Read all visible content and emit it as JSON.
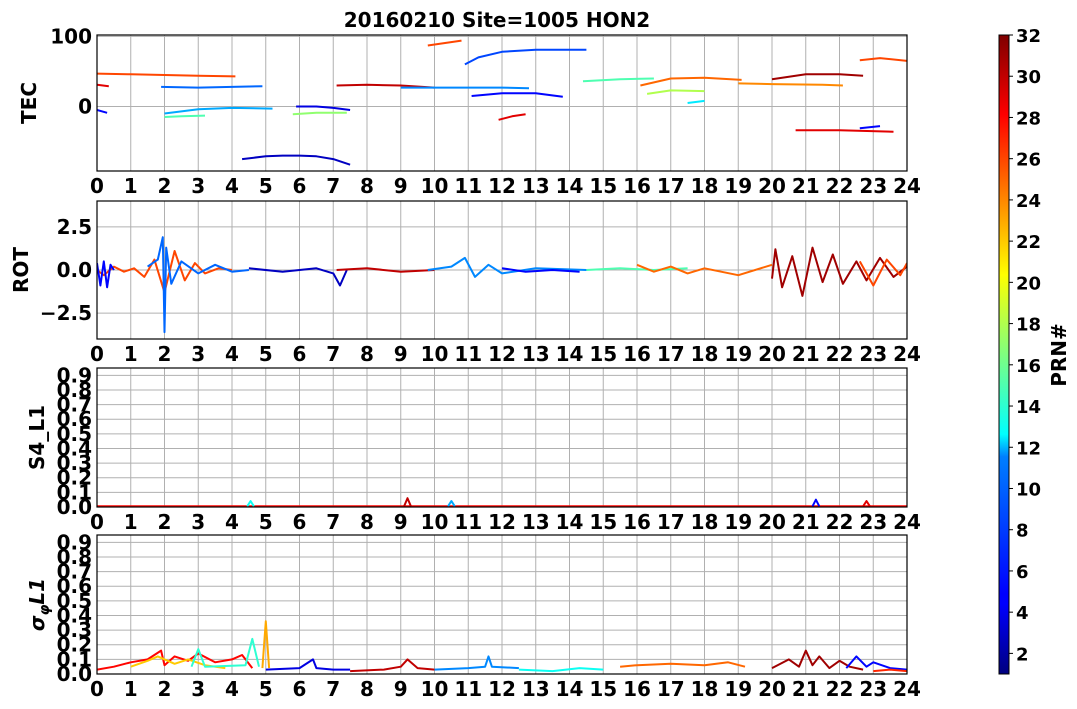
{
  "title": "20160210 Site=1005 HON2",
  "colorbar": {
    "label": "PRN#",
    "min": 1,
    "max": 32,
    "ticks": [
      "2",
      "4",
      "6",
      "8",
      "10",
      "12",
      "14",
      "16",
      "18",
      "20",
      "22",
      "24",
      "26",
      "28",
      "30",
      "32"
    ],
    "colormap": "jet"
  },
  "x_ticks": [
    "0",
    "1",
    "2",
    "3",
    "4",
    "5",
    "6",
    "7",
    "8",
    "9",
    "10",
    "11",
    "12",
    "13",
    "14",
    "15",
    "16",
    "17",
    "18",
    "19",
    "20",
    "21",
    "22",
    "23",
    "24"
  ],
  "panels": [
    {
      "id": "tec",
      "ylabel": "TEC",
      "y_ticks": [
        "0",
        "100"
      ],
      "y_tick_values": [
        0,
        100
      ]
    },
    {
      "id": "rot",
      "ylabel": "ROT",
      "y_ticks": [
        "−2.5",
        "0.0",
        "2.5"
      ],
      "y_tick_values": [
        -2.5,
        0,
        2.5
      ]
    },
    {
      "id": "s4",
      "ylabel": "S4_L1",
      "y_ticks": [
        "0.0",
        "0.1",
        "0.2",
        "0.3",
        "0.4",
        "0.5",
        "0.6",
        "0.7",
        "0.8",
        "0.9"
      ],
      "y_tick_values": [
        0,
        0.1,
        0.2,
        0.3,
        0.4,
        0.5,
        0.6,
        0.7,
        0.8,
        0.9
      ]
    },
    {
      "id": "sigma",
      "ylabel": "σφL1",
      "y_ticks": [
        "0.0",
        "0.1",
        "0.2",
        "0.3",
        "0.4",
        "0.5",
        "0.6",
        "0.7",
        "0.8",
        "0.9"
      ],
      "y_tick_values": [
        0,
        0.1,
        0.2,
        0.3,
        0.4,
        0.5,
        0.6,
        0.7,
        0.8,
        0.9
      ]
    }
  ],
  "chart_data": [
    {
      "type": "line",
      "panel": "tec",
      "title": "20160210 Site=1005 HON2",
      "xlabel": "",
      "ylabel": "TEC",
      "xlim": [
        0,
        24
      ],
      "ylim": [
        -92,
        102
      ],
      "grid": true,
      "series": [
        {
          "prn": 26,
          "x": [
            0,
            1,
            2,
            3,
            4.1
          ],
          "y": [
            47,
            46,
            45,
            44,
            43
          ]
        },
        {
          "prn": 29,
          "x": [
            0,
            0.35
          ],
          "y": [
            31,
            29
          ]
        },
        {
          "prn": 5,
          "x": [
            0,
            0.3
          ],
          "y": [
            -5,
            -9
          ]
        },
        {
          "prn": 8,
          "x": [
            1.9,
            3,
            4,
            4.9
          ],
          "y": [
            28,
            27,
            28,
            29
          ]
        },
        {
          "prn": 10,
          "x": [
            2,
            3,
            4,
            5.2
          ],
          "y": [
            -10,
            -4,
            -2,
            -3
          ]
        },
        {
          "prn": 15,
          "x": [
            2,
            2.5,
            3.2
          ],
          "y": [
            -15,
            -14,
            -13
          ]
        },
        {
          "prn": 3,
          "x": [
            4.3,
            5,
            5.5,
            6,
            6.5,
            7,
            7.5
          ],
          "y": [
            -75,
            -71,
            -70,
            -70,
            -71,
            -75,
            -83
          ]
        },
        {
          "prn": 4,
          "x": [
            5.9,
            6.5,
            7,
            7.5
          ],
          "y": [
            0,
            0,
            -2,
            -5
          ]
        },
        {
          "prn": 17,
          "x": [
            5.8,
            6.5,
            7.4
          ],
          "y": [
            -11,
            -9,
            -9
          ]
        },
        {
          "prn": 30,
          "x": [
            7.1,
            8,
            9,
            10
          ],
          "y": [
            30,
            31,
            30,
            27
          ]
        },
        {
          "prn": 9,
          "x": [
            9,
            10,
            11,
            12,
            12.8
          ],
          "y": [
            27,
            27,
            27,
            27,
            26
          ]
        },
        {
          "prn": 26,
          "x": [
            9.8,
            10.8
          ],
          "y": [
            87,
            94
          ]
        },
        {
          "prn": 7,
          "x": [
            10.9,
            11.3,
            12,
            13,
            14.5
          ],
          "y": [
            60,
            70,
            78,
            81,
            81
          ]
        },
        {
          "prn": 5,
          "x": [
            11.1,
            12,
            13,
            13.8
          ],
          "y": [
            15,
            19,
            19,
            14
          ]
        },
        {
          "prn": 29,
          "x": [
            11.9,
            12.3,
            12.7
          ],
          "y": [
            -19,
            -14,
            -11
          ]
        },
        {
          "prn": 15,
          "x": [
            14.4,
            15.5,
            16.5
          ],
          "y": [
            36,
            39,
            40
          ]
        },
        {
          "prn": 25,
          "x": [
            16.1,
            17,
            18,
            19.1
          ],
          "y": [
            30,
            40,
            41,
            38
          ]
        },
        {
          "prn": 18,
          "x": [
            16.3,
            17,
            18
          ],
          "y": [
            18,
            23,
            22
          ]
        },
        {
          "prn": 12,
          "x": [
            17.5,
            18
          ],
          "y": [
            5,
            8
          ]
        },
        {
          "prn": 24,
          "x": [
            19,
            20,
            21.5,
            22.1
          ],
          "y": [
            33,
            32,
            31,
            30
          ]
        },
        {
          "prn": 31,
          "x": [
            20,
            21,
            22,
            22.7
          ],
          "y": [
            39,
            46,
            46,
            44
          ]
        },
        {
          "prn": 26,
          "x": [
            22.6,
            23.2,
            24
          ],
          "y": [
            66,
            69,
            65
          ]
        },
        {
          "prn": 29,
          "x": [
            20.7,
            22,
            23.6
          ],
          "y": [
            -34,
            -34,
            -36
          ]
        },
        {
          "prn": 5,
          "x": [
            22.6,
            23.2
          ],
          "y": [
            -31,
            -28
          ]
        }
      ]
    },
    {
      "type": "line",
      "panel": "rot",
      "xlabel": "",
      "ylabel": "ROT",
      "xlim": [
        0,
        24
      ],
      "ylim": [
        -4,
        4
      ],
      "grid": true,
      "series": [
        {
          "prn": 26,
          "x": [
            0,
            0.2,
            0.5,
            0.8,
            1.1,
            1.4,
            1.7,
            2.0,
            2.3,
            2.6,
            2.9,
            3.2,
            3.6,
            4.0
          ],
          "y": [
            0,
            -0.3,
            0.2,
            -0.1,
            0.1,
            -0.4,
            0.6,
            -1.3,
            1.1,
            -0.6,
            0.4,
            -0.2,
            0.1,
            0
          ]
        },
        {
          "prn": 5,
          "x": [
            0,
            0.1,
            0.2,
            0.3,
            0.4,
            0.5
          ],
          "y": [
            0.4,
            -0.9,
            0.5,
            -1.0,
            0.3,
            0
          ]
        },
        {
          "prn": 8,
          "x": [
            1.5,
            1.8,
            1.95,
            2.0,
            2.05,
            2.2,
            2.5,
            3.0,
            3.5,
            4.0,
            4.5
          ],
          "y": [
            0.2,
            0.6,
            1.9,
            -3.6,
            1.3,
            -0.8,
            0.5,
            -0.2,
            0.3,
            -0.1,
            0
          ]
        },
        {
          "prn": 3,
          "x": [
            4.5,
            5.5,
            6.5,
            7.0,
            7.2,
            7.4
          ],
          "y": [
            0.1,
            -0.1,
            0.1,
            -0.2,
            -0.9,
            0
          ]
        },
        {
          "prn": 30,
          "x": [
            7.1,
            8,
            9,
            10
          ],
          "y": [
            0,
            0.1,
            -0.1,
            0
          ]
        },
        {
          "prn": 9,
          "x": [
            9.8,
            10.5,
            10.9,
            11.2,
            11.6,
            12,
            13,
            14.5
          ],
          "y": [
            0,
            0.2,
            0.7,
            -0.4,
            0.3,
            -0.2,
            0.1,
            0
          ]
        },
        {
          "prn": 5,
          "x": [
            12,
            12.7,
            13.5,
            14.3
          ],
          "y": [
            0.1,
            -0.1,
            0,
            -0.1
          ]
        },
        {
          "prn": 15,
          "x": [
            14.5,
            15.5,
            16.5,
            17.5
          ],
          "y": [
            0,
            0.1,
            0,
            0.1
          ]
        },
        {
          "prn": 25,
          "x": [
            16,
            16.5,
            17,
            17.5,
            18,
            19,
            20
          ],
          "y": [
            0.3,
            -0.1,
            0.2,
            -0.2,
            0.1,
            -0.3,
            0.3
          ]
        },
        {
          "prn": 31,
          "x": [
            20,
            20.1,
            20.3,
            20.6,
            20.9,
            21.2,
            21.5,
            21.8,
            22.1,
            22.5,
            22.8,
            23.2,
            23.6,
            24
          ],
          "y": [
            -0.5,
            1.2,
            -1.0,
            0.8,
            -1.5,
            1.3,
            -0.7,
            0.9,
            -0.8,
            0.5,
            -0.6,
            0.7,
            -0.4,
            0.2
          ]
        },
        {
          "prn": 26,
          "x": [
            22.6,
            23,
            23.4,
            23.8,
            24
          ],
          "y": [
            0.5,
            -0.9,
            0.6,
            -0.3,
            0.4
          ]
        }
      ]
    },
    {
      "type": "line",
      "panel": "s4",
      "xlabel": "",
      "ylabel": "S4_L1",
      "xlim": [
        0,
        24
      ],
      "ylim": [
        0,
        0.95
      ],
      "grid": true,
      "series": [
        {
          "prn": 28,
          "x": [
            0,
            24
          ],
          "y": [
            0.005,
            0.005
          ]
        },
        {
          "prn": 13,
          "x": [
            4.45,
            4.55,
            4.65
          ],
          "y": [
            0.005,
            0.04,
            0.005
          ]
        },
        {
          "prn": 30,
          "x": [
            9.1,
            9.2,
            9.3
          ],
          "y": [
            0.005,
            0.06,
            0.005
          ]
        },
        {
          "prn": 10,
          "x": [
            10.4,
            10.5,
            10.6
          ],
          "y": [
            0.005,
            0.04,
            0.005
          ]
        },
        {
          "prn": 5,
          "x": [
            21.2,
            21.3,
            21.4
          ],
          "y": [
            0.005,
            0.05,
            0.005
          ]
        },
        {
          "prn": 29,
          "x": [
            22.7,
            22.8,
            22.9
          ],
          "y": [
            0.005,
            0.04,
            0.005
          ]
        }
      ]
    },
    {
      "type": "line",
      "panel": "sigma",
      "xlabel": "",
      "ylabel": "σφL1",
      "xlim": [
        0,
        24
      ],
      "ylim": [
        0,
        0.95
      ],
      "grid": true,
      "series": [
        {
          "prn": 28,
          "x": [
            0,
            0.5,
            1,
            1.5,
            1.9,
            2.0,
            2.3,
            2.7,
            3.0,
            3.5,
            4.0,
            4.3,
            4.6
          ],
          "y": [
            0.03,
            0.05,
            0.08,
            0.1,
            0.16,
            0.06,
            0.12,
            0.09,
            0.14,
            0.08,
            0.1,
            0.13,
            0.04
          ]
        },
        {
          "prn": 22,
          "x": [
            1,
            1.5,
            1.8,
            2.3,
            2.7,
            3.2,
            3.8
          ],
          "y": [
            0.05,
            0.09,
            0.12,
            0.07,
            0.1,
            0.06,
            0.04
          ]
        },
        {
          "prn": 14,
          "x": [
            2.8,
            3.0,
            3.2,
            4.4,
            4.6,
            4.8
          ],
          "y": [
            0.05,
            0.17,
            0.05,
            0.06,
            0.24,
            0.05
          ]
        },
        {
          "prn": 23,
          "x": [
            4.9,
            5.0,
            5.1
          ],
          "y": [
            0.04,
            0.36,
            0.04
          ]
        },
        {
          "prn": 4,
          "x": [
            5,
            6,
            6.4,
            6.5,
            7,
            7.5
          ],
          "y": [
            0.03,
            0.04,
            0.1,
            0.04,
            0.03,
            0.03
          ]
        },
        {
          "prn": 30,
          "x": [
            7.5,
            8.5,
            9,
            9.2,
            9.5,
            10
          ],
          "y": [
            0.02,
            0.03,
            0.05,
            0.1,
            0.04,
            0.03
          ]
        },
        {
          "prn": 9,
          "x": [
            10,
            11,
            11.5,
            11.6,
            11.7,
            12.5
          ],
          "y": [
            0.03,
            0.04,
            0.05,
            0.12,
            0.05,
            0.04
          ]
        },
        {
          "prn": 13,
          "x": [
            12.5,
            13.5,
            14.3,
            15
          ],
          "y": [
            0.03,
            0.02,
            0.04,
            0.03
          ]
        },
        {
          "prn": 25,
          "x": [
            15.5,
            16,
            17,
            18,
            18.7,
            19.2
          ],
          "y": [
            0.05,
            0.06,
            0.07,
            0.06,
            0.08,
            0.05
          ]
        },
        {
          "prn": 31,
          "x": [
            20,
            20.5,
            20.8,
            21,
            21.2,
            21.4,
            21.7,
            22,
            22.3,
            22.7
          ],
          "y": [
            0.04,
            0.1,
            0.05,
            0.16,
            0.06,
            0.12,
            0.04,
            0.09,
            0.05,
            0.03
          ]
        },
        {
          "prn": 5,
          "x": [
            22.2,
            22.5,
            22.8,
            23.0,
            23.5,
            24
          ],
          "y": [
            0.04,
            0.12,
            0.05,
            0.08,
            0.04,
            0.03
          ]
        },
        {
          "prn": 27,
          "x": [
            23,
            23.5,
            24
          ],
          "y": [
            0.02,
            0.03,
            0.02
          ]
        }
      ]
    }
  ]
}
